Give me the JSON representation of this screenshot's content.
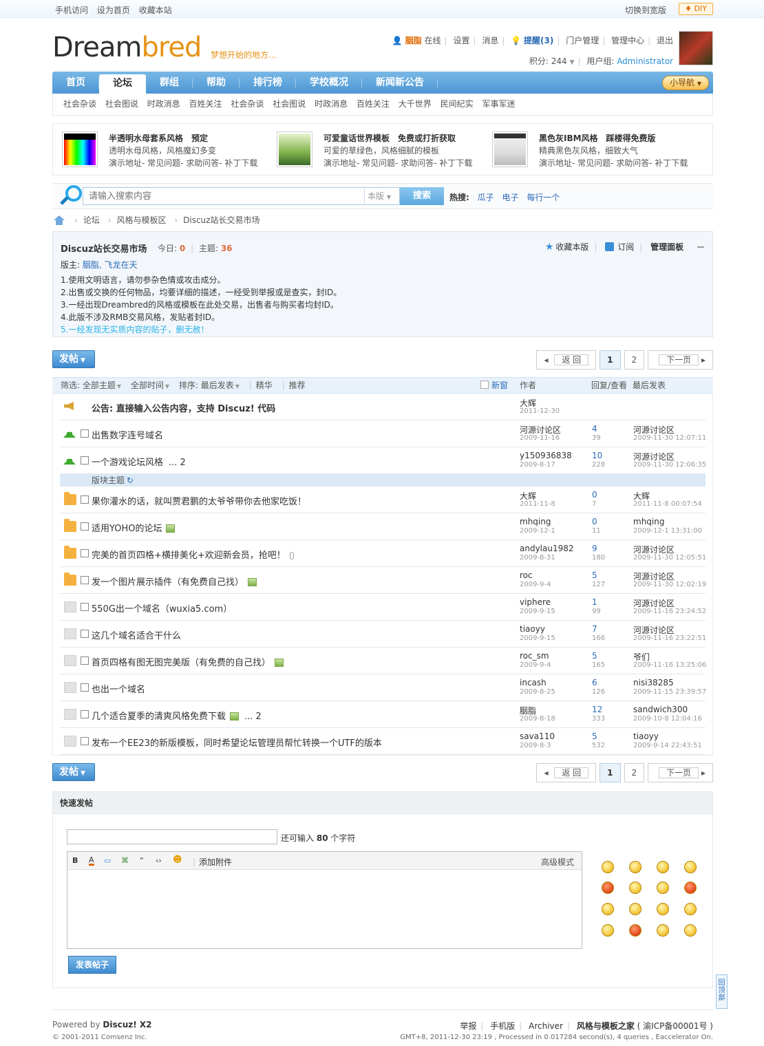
{
  "topbar": {
    "links": [
      "手机访问",
      "设为首页",
      "收藏本站"
    ],
    "wide": "切换到宽版",
    "diy": "DIY"
  },
  "logo": {
    "part1": "Dream",
    "part2": "bred",
    "slogan": "梦想开始的地方..."
  },
  "user": {
    "name": "胭脂",
    "status": "在线",
    "settings": "设置",
    "messages": "消息",
    "remind": "提醒(3)",
    "portal": "门户管理",
    "admin": "管理中心",
    "logout": "退出",
    "points_label": "积分: 244",
    "group_label": "用户组:",
    "group": "Administrator"
  },
  "nav": {
    "items": [
      "首页",
      "论坛",
      "群组",
      "帮助",
      "排行榜",
      "学校概况",
      "新闻新公告"
    ],
    "quick": "小导航"
  },
  "subnav": [
    "社会杂谈",
    "社会图说",
    "时政消息",
    "百姓关注",
    "社会杂谈",
    "社会图说",
    "时政消息",
    "百姓关注",
    "大千世界",
    "民间纪实",
    "军事军迷"
  ],
  "ads": [
    {
      "title": "半透明水母套系风格　预定",
      "desc": "透明水母风格，风格魔幻多变",
      "links": "演示地址- 常见问题- 求助问答- 补丁下载"
    },
    {
      "title": "可爱童话世界模板　免费或打折获取",
      "desc": "可爱的草绿色，风格细腻的模板",
      "links": "演示地址- 常见问题- 求助问答- 补丁下载"
    },
    {
      "title": "黑色灰IBM风格　踩楼得免费版",
      "desc": "精典黑色灰风格，细致大气",
      "links": "演示地址- 常见问题- 求助问答- 补丁下载"
    }
  ],
  "search": {
    "placeholder": "请输入搜索内容",
    "scope": "本版",
    "button": "搜索",
    "hot_label": "热搜:",
    "hot": [
      "瓜子",
      "电子",
      "每行一个"
    ]
  },
  "breadcrumb": [
    "论坛",
    "风格与模板区",
    "Discuz站长交易市场"
  ],
  "forum": {
    "name": "Discuz站长交易市场",
    "today_label": "今日:",
    "today": "0",
    "topics_label": "主题:",
    "topics": "36",
    "mod_label": "版主:",
    "mods": "胭脂, 飞龙在天",
    "fav": "收藏本版",
    "rss": "订阅",
    "panel": "管理面板",
    "rules": [
      "1.使用文明语言，请勿参杂色情或攻击成分。",
      "2.出售或交换的任何物品，均要详细的描述，一经受到举报或是查实，封ID。",
      "3.一经出现Dreambred的风格或模板在此处交易，出售者与购买者均封ID。",
      "4.此版不涉及RMB交易风格，发贴者封ID。"
    ],
    "rule_hl": "5.一经发现无实质内容的贴子，删无赦！"
  },
  "pager": {
    "post": "发帖",
    "back": "返 回",
    "pages": [
      "1",
      "2"
    ],
    "next": "下一页"
  },
  "filters": {
    "all": "筛选: 全部主题",
    "time": "全部时间",
    "sort": "排序: 最后发表",
    "digest": "精华",
    "recommend": "推荐",
    "newwin": "新窗",
    "author": "作者",
    "replies": "回复/查看",
    "last": "最后发表"
  },
  "announcement": {
    "title": "公告: 直接输入公告内容，支持 Discuz! 代码",
    "author": "大辉",
    "date": "2011-12-30"
  },
  "sticky": [
    {
      "title": "出售数字连号域名",
      "author": "河源讨论区",
      "date": "2009-11-16",
      "replies": "4",
      "views": "39",
      "last_user": "河源讨论区",
      "last_time": "2009-11-30 12:07:11"
    },
    {
      "title": "一个游戏论坛风格",
      "more": "... 2",
      "author": "y150936838",
      "date": "2009-8-17",
      "replies": "10",
      "views": "228",
      "last_user": "河源讨论区",
      "last_time": "2009-11-30 12:06:35"
    }
  ],
  "section_label": "版块主题",
  "threads": [
    {
      "title": "果你灌水的话，就叫贾君鹏的太爷爷带你去他家吃饭！",
      "icon": "folder",
      "author": "大辉",
      "date": "2011-11-8",
      "replies": "0",
      "views": "7",
      "last_user": "大辉",
      "last_time": "2011-11-8 00:07:54"
    },
    {
      "title": "适用YOHO的论坛",
      "icon": "folder",
      "pic": true,
      "author": "mhqing",
      "date": "2009-12-1",
      "replies": "0",
      "views": "11",
      "last_user": "mhqing",
      "last_time": "2009-12-1 13:31:00"
    },
    {
      "title": "完美的首页四格+横排美化+欢迎新会员，抢吧！",
      "icon": "folder",
      "clip": true,
      "author": "andylau1982",
      "date": "2009-8-31",
      "replies": "9",
      "views": "180",
      "last_user": "河源讨论区",
      "last_time": "2009-11-30 12:05:51"
    },
    {
      "title": "发一个图片展示插件（有免费自己找）",
      "icon": "folder",
      "pic": true,
      "author": "roc",
      "date": "2009-9-4",
      "replies": "5",
      "views": "127",
      "last_user": "河源讨论区",
      "last_time": "2009-11-30 12:02:19"
    },
    {
      "title": "550G出一个域名（wuxia5.com）",
      "icon": "gray",
      "author": "viphere",
      "date": "2009-9-15",
      "replies": "1",
      "views": "99",
      "last_user": "河源讨论区",
      "last_time": "2009-11-16 23:24:52"
    },
    {
      "title": "这几个域名适合干什么",
      "icon": "gray",
      "author": "tiaoyy",
      "date": "2009-9-15",
      "replies": "7",
      "views": "166",
      "last_user": "河源讨论区",
      "last_time": "2009-11-16 23:22:51"
    },
    {
      "title": "首页四格有图无图完美版（有免费的自己找）",
      "icon": "gray",
      "pic": true,
      "author": "roc_sm",
      "date": "2009-9-4",
      "replies": "5",
      "views": "165",
      "last_user": "爷们",
      "last_time": "2009-11-16 13:25:06"
    },
    {
      "title": "也出一个域名",
      "icon": "gray",
      "author": "incash",
      "date": "2009-8-25",
      "replies": "6",
      "views": "126",
      "last_user": "nisi38285",
      "last_time": "2009-11-15 23:39:57"
    },
    {
      "title": "几个适合夏季的清爽风格免费下载",
      "icon": "gray",
      "pic": true,
      "more": "... 2",
      "author": "胭脂",
      "date": "2009-8-18",
      "replies": "12",
      "views": "333",
      "last_user": "sandwich300",
      "last_time": "2009-10-8 12:04:16"
    },
    {
      "title": "发布一个EE23的新版模板，同时希望论坛管理员帮忙转换一个UTF的版本",
      "icon": "gray",
      "author": "sava110",
      "date": "2009-8-3",
      "replies": "5",
      "views": "532",
      "last_user": "tiaoyy",
      "last_time": "2009-9-14 22:43:51"
    }
  ],
  "quickpost": {
    "header": "快速发帖",
    "remain_pre": "还可输入",
    "remain": "80",
    "remain_post": "个字符",
    "attach": "添加附件",
    "advanced": "高级模式",
    "submit": "发表帖子",
    "toolbar": [
      "B",
      "A",
      "▭",
      "⌘",
      "“",
      "‹›",
      "☻"
    ]
  },
  "footer": {
    "powered_pre": "Powered by",
    "powered": "Discuz! X2",
    "copyright": "© 2001-2011 Comsenz Inc.",
    "links": [
      "举报",
      "手机版",
      "Archiver"
    ],
    "site": "风格与模板之家",
    "icp": "( 渝ICP备00001号 )",
    "gmt": "GMT+8, 2011-12-30 23:19 , Processed in 0.017284 second(s), 4 queries , Eaccelerator On."
  },
  "totop": "回顶部"
}
